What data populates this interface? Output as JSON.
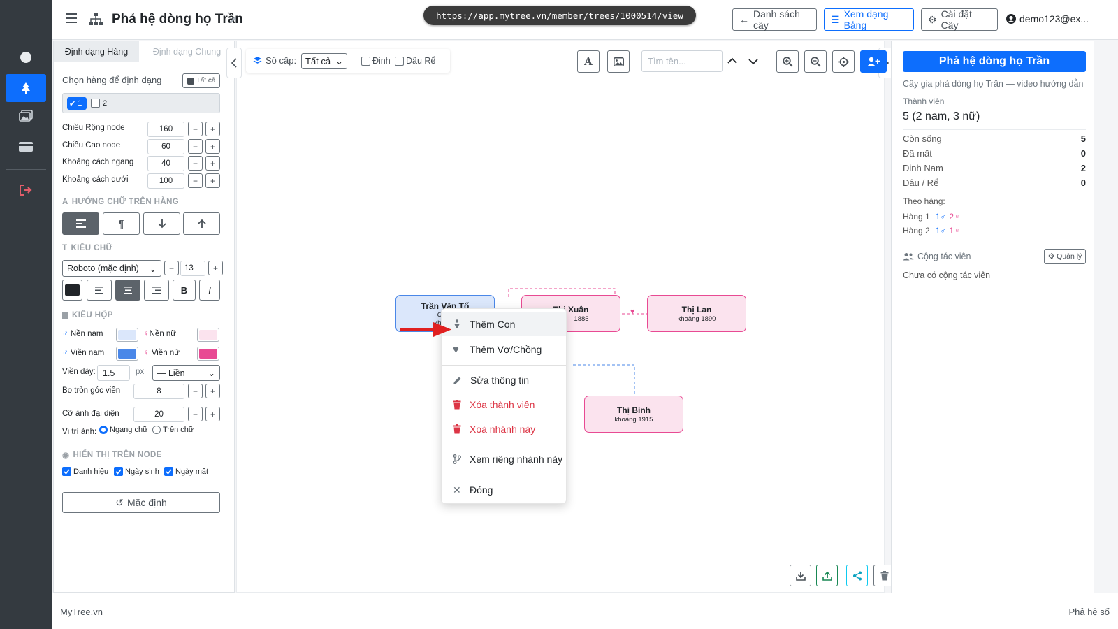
{
  "header": {
    "title": "Phả hệ dòng họ Trần",
    "url": "https://app.mytree.vn/member/trees/1000514/view",
    "btn_list": "Danh sách cây",
    "btn_table": "Xem dạng Bảng",
    "btn_settings": "Cài đặt Cây",
    "user": "demo123@ex..."
  },
  "left": {
    "tab_row": "Định dạng Hàng",
    "tab_general": "Định dạng Chung",
    "choose_rows": "Chọn hàng để định dạng",
    "all_btn": "Tất cả",
    "row_options": [
      "1",
      "2"
    ],
    "node_width_label": "Chiều Rộng node",
    "node_width": "160",
    "node_height_label": "Chiều Cao node",
    "node_height": "60",
    "h_gap_label": "Khoảng cách ngang",
    "h_gap": "40",
    "v_gap_label": "Khoảng cách dưới",
    "v_gap": "100",
    "text_dir_heading": "HƯỚNG CHỮ TRÊN HÀNG",
    "font_heading": "KIỂU CHỮ",
    "font_family": "Roboto (mặc định)",
    "font_size": "13",
    "bold": "B",
    "italic": "I",
    "box_heading": "KIỂU HỘP",
    "bg_male": "Nền nam",
    "bg_female": "Nền nữ",
    "border_male": "Viền nam",
    "border_female": "Viền nữ",
    "border_width_label": "Viền dày:",
    "border_width": "1.5",
    "px": "px",
    "border_style": "— Liền",
    "radius_label": "Bo tròn góc viền",
    "radius": "8",
    "avatar_label": "Cỡ ảnh đại diện",
    "avatar": "20",
    "img_pos_label": "Vị trí ảnh:",
    "img_pos_horizontal": "Ngang chữ",
    "img_pos_above": "Trên chữ",
    "display_heading": "HIỂN THỊ TRÊN NODE",
    "show_title": "Danh hiệu",
    "show_birth": "Ngày sinh",
    "show_death": "Ngày mất",
    "reset": "Mặc định",
    "colors": {
      "male_bg": "#dbe7fb",
      "female_bg": "#fbe3ee",
      "male_border": "#4a87e8",
      "female_border": "#e84a93",
      "text": "#212529"
    }
  },
  "toolbar": {
    "levels_label": "Số cấp:",
    "levels_value": "Tất cả",
    "dinh": "Đinh",
    "dau_re": "Dâu Rể",
    "search_placeholder": "Tìm tên..."
  },
  "tree": {
    "nodes": [
      {
        "name": "Trần Văn Tố",
        "title": "Cụ tổ",
        "date": "khoảng",
        "gender": "male"
      },
      {
        "name": "Thị Xuân",
        "date": "1885",
        "gender": "female"
      },
      {
        "name": "Thị Lan",
        "date": "khoảng 1890",
        "gender": "female"
      },
      {
        "name": "Thị Bình",
        "date": "khoảng 1915",
        "gender": "female"
      }
    ]
  },
  "menu": {
    "add_child": "Thêm Con",
    "add_spouse": "Thêm Vợ/Chồng",
    "edit": "Sửa thông tin",
    "delete_member": "Xóa thành viên",
    "delete_branch": "Xoá nhánh này",
    "view_branch": "Xem riêng nhánh này",
    "close": "Đóng"
  },
  "right": {
    "title": "Phả hệ dòng họ Trần",
    "desc": "Cây gia phả dòng họ Trần — video hướng dẫn",
    "members_label": "Thành viên",
    "members": "5 (2 nam, 3 nữ)",
    "alive_label": "Còn sống",
    "alive": "5",
    "dead_label": "Đã mất",
    "dead": "0",
    "dinh_label": "Đinh Nam",
    "dinh": "2",
    "dau_label": "Dâu / Rể",
    "dau": "0",
    "by_row": "Theo hàng:",
    "row1_label": "Hàng 1",
    "row1_m": "1♂",
    "row1_f": "2♀",
    "row2_label": "Hàng 2",
    "row2_m": "1♂",
    "row2_f": "1♀",
    "collab_label": "Cộng tác viên",
    "manage": "Quản lý",
    "no_collab": "Chưa có cộng tác viên"
  },
  "footer": {
    "left": "MyTree.vn",
    "right": "Phả hệ số"
  }
}
